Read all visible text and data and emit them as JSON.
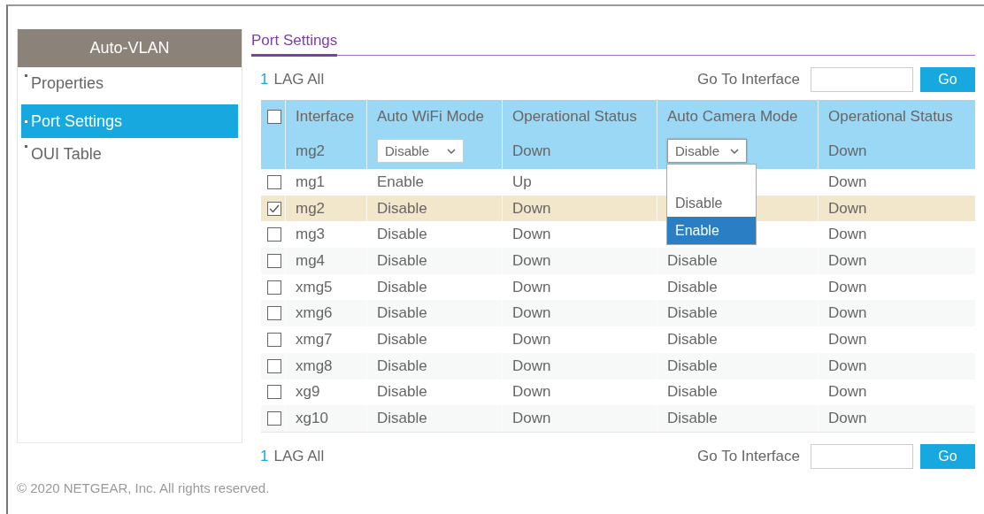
{
  "sidebar": {
    "title": "Auto-VLAN",
    "items": [
      {
        "label": "Properties",
        "selected": false
      },
      {
        "label": "Port Settings",
        "selected": true
      },
      {
        "label": "OUI Table",
        "selected": false
      }
    ]
  },
  "tab": {
    "label": "Port Settings",
    "selected": true
  },
  "pager_top": {
    "page": "1",
    "lag_all": "LAG All",
    "goto_label": "Go To Interface",
    "go_button": "Go"
  },
  "table": {
    "header_checked": false,
    "columns": [
      "Interface",
      "Auto WiFi Mode",
      "Operational Status",
      "Auto Camera Mode",
      "Operational Status"
    ],
    "edit_row": {
      "interface": "mg2",
      "wifi_mode": "Disable",
      "wifi_status": "Down",
      "camera_mode": "Disable",
      "camera_status": "Down"
    },
    "camera_dropdown": {
      "expanded": true,
      "options": [
        {
          "label": "Disable",
          "selected": false
        },
        {
          "label": "Enable",
          "selected": true
        }
      ]
    },
    "rows": [
      {
        "checked": false,
        "interface": "mg1",
        "wifi_mode": "Enable",
        "wifi_status": "Up",
        "camera_status": "Down"
      },
      {
        "checked": true,
        "interface": "mg2",
        "wifi_mode": "Disable",
        "wifi_status": "Down",
        "camera_status": "Down"
      },
      {
        "checked": false,
        "interface": "mg3",
        "wifi_mode": "Disable",
        "wifi_status": "Down",
        "camera_status": "Down"
      },
      {
        "checked": false,
        "interface": "mg4",
        "wifi_mode": "Disable",
        "wifi_status": "Down",
        "camera_mode": "Disable",
        "camera_status": "Down"
      },
      {
        "checked": false,
        "interface": "xmg5",
        "wifi_mode": "Disable",
        "wifi_status": "Down",
        "camera_mode": "Disable",
        "camera_status": "Down"
      },
      {
        "checked": false,
        "interface": "xmg6",
        "wifi_mode": "Disable",
        "wifi_status": "Down",
        "camera_mode": "Disable",
        "camera_status": "Down"
      },
      {
        "checked": false,
        "interface": "xmg7",
        "wifi_mode": "Disable",
        "wifi_status": "Down",
        "camera_mode": "Disable",
        "camera_status": "Down"
      },
      {
        "checked": false,
        "interface": "xmg8",
        "wifi_mode": "Disable",
        "wifi_status": "Down",
        "camera_mode": "Disable",
        "camera_status": "Down"
      },
      {
        "checked": false,
        "interface": "xg9",
        "wifi_mode": "Disable",
        "wifi_status": "Down",
        "camera_mode": "Disable",
        "camera_status": "Down"
      },
      {
        "checked": false,
        "interface": "xg10",
        "wifi_mode": "Disable",
        "wifi_status": "Down",
        "camera_mode": "Disable",
        "camera_status": "Down"
      }
    ]
  },
  "pager_bottom": {
    "page": "1",
    "lag_all": "LAG All",
    "goto_label": "Go To Interface",
    "go_button": "Go"
  },
  "footer": "© 2020 NETGEAR, Inc. All rights reserved."
}
